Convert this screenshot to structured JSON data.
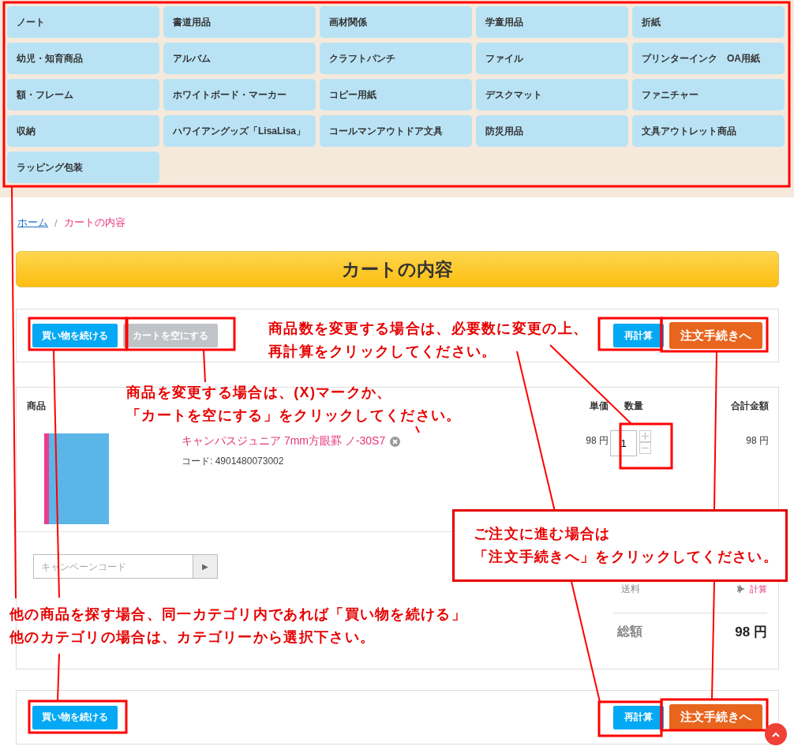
{
  "categories": [
    {
      "label": "ノート"
    },
    {
      "label": "書道用品"
    },
    {
      "label": "画材関係"
    },
    {
      "label": "学童用品"
    },
    {
      "label": "折紙"
    },
    {
      "label": "幼児・知育商品"
    },
    {
      "label": "アルバム"
    },
    {
      "label": "クラフトパンチ"
    },
    {
      "label": "ファイル"
    },
    {
      "label": "プリンターインク　OA用紙"
    },
    {
      "label": "額・フレーム"
    },
    {
      "label": "ホワイトボード・マーカー"
    },
    {
      "label": "コピー用紙"
    },
    {
      "label": "デスクマット"
    },
    {
      "label": "ファニチャー"
    },
    {
      "label": "収納"
    },
    {
      "label": "ハワイアングッズ「LisaLisa」"
    },
    {
      "label": "コールマンアウトドア文具"
    },
    {
      "label": "防災用品"
    },
    {
      "label": "文具アウトレット商品"
    },
    {
      "label": "ラッピング包装"
    }
  ],
  "breadcrumb": {
    "home": "ホーム",
    "separator": "/",
    "current": "カートの内容"
  },
  "page_title": "カートの内容",
  "top_actions": {
    "continue": "買い物を続ける",
    "empty_cart": "カートを空にする",
    "recalculate": "再計算",
    "checkout": "注文手続きへ"
  },
  "cart_table": {
    "columns": [
      "商品",
      "単価",
      "数量",
      "合計金額"
    ],
    "rows": [
      {
        "name": "キャンパスジュニア 7mm方眼罫 ノ-30S7",
        "code": "コード: 4901480073002",
        "price": "98 円",
        "quantity": "1",
        "total": "98 円"
      }
    ]
  },
  "campaign_code": {
    "placeholder": "キャンペーンコード",
    "submit": "▶"
  },
  "summary": {
    "shipping_label": "送料",
    "shipping_action": "計算",
    "total_label": "総額",
    "total": "98 円"
  },
  "bottom_actions": {
    "continue": "買い物を続ける",
    "recalculate": "再計算",
    "checkout": "注文手続きへ"
  },
  "annotations": [
    {
      "kind": "text",
      "lines": [
        "商品数を変更する場合は、必要数に変更の上、",
        "再計算をクリックしてください。"
      ]
    },
    {
      "kind": "text",
      "lines": [
        "商品を変更する場合は、(X)マークか、",
        "「カートを空にする」をクリックしてください。"
      ]
    },
    {
      "kind": "callout",
      "lines": [
        "ご注文に進む場合は",
        "「注文手続きへ」をクリックしてください。"
      ]
    },
    {
      "kind": "text",
      "lines": [
        "他の商品を探す場合、同一カテゴリ内であれば「買い物を続ける」",
        "他のカテゴリの場合は、カテゴリーから選択下さい。"
      ]
    }
  ]
}
